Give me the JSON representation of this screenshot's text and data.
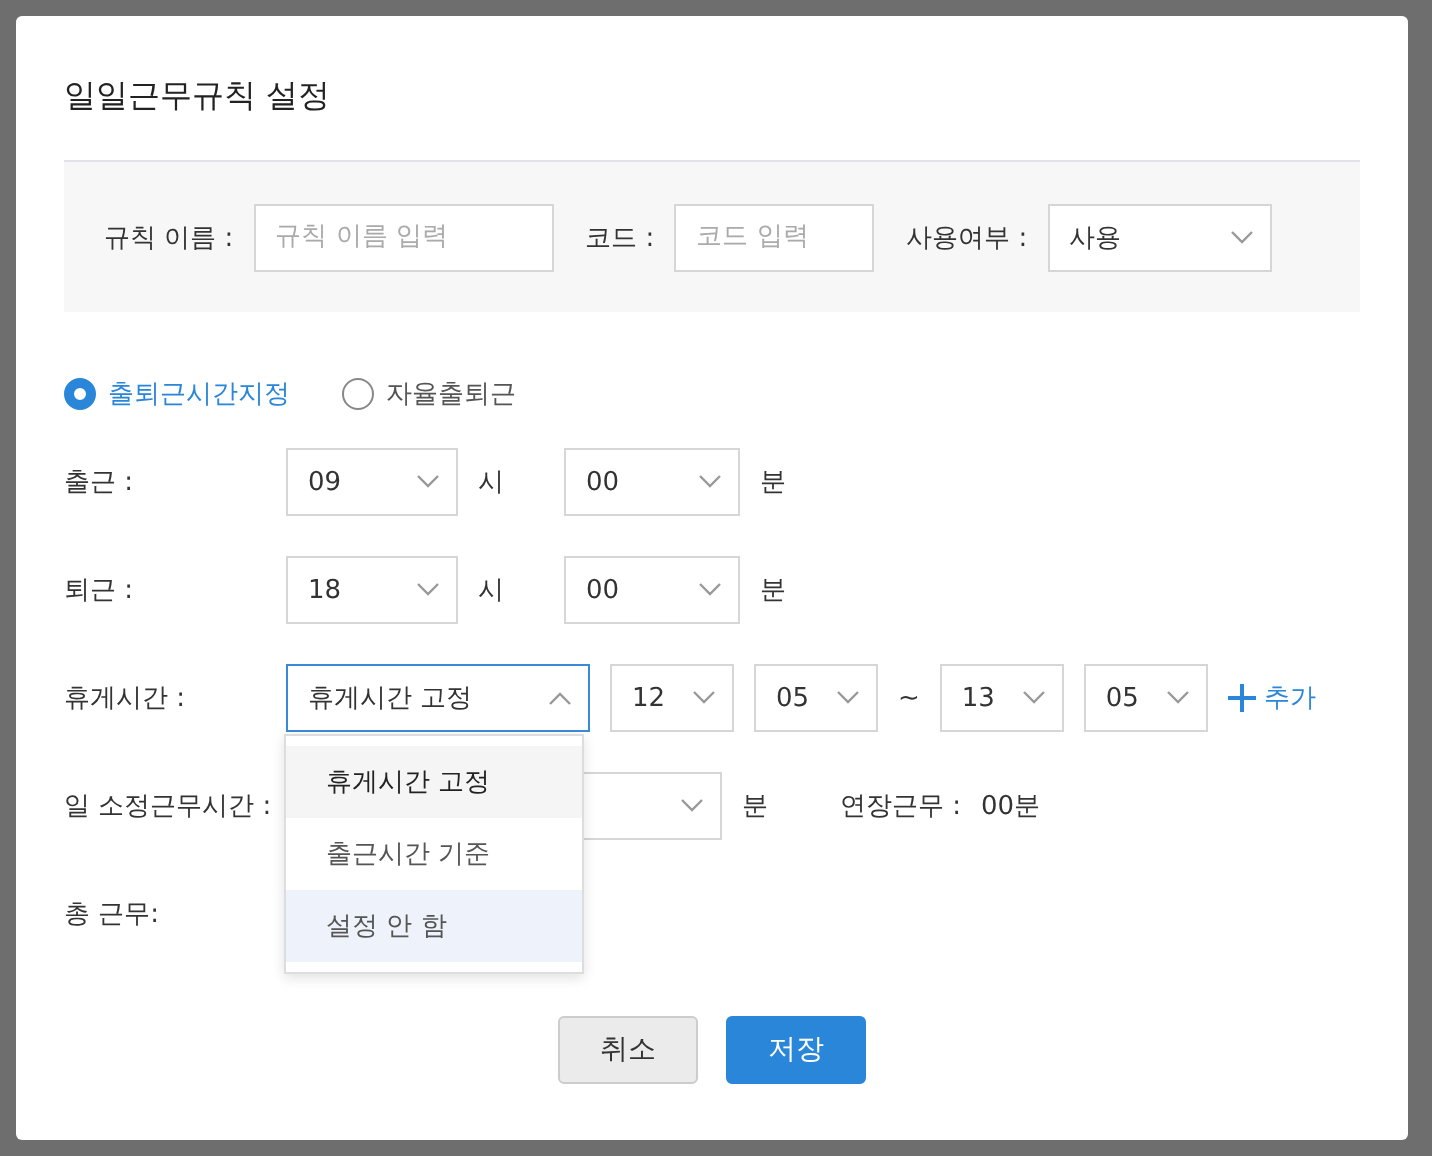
{
  "dialog": {
    "title": "일일근무규칙 설정"
  },
  "filter_bar": {
    "name_label": "규칙 이름 :",
    "name_placeholder": "규칙 이름 입력",
    "code_label": "코드 :",
    "code_placeholder": "코드 입력",
    "use_label": "사용여부 :",
    "use_value": "사용"
  },
  "mode_options": [
    {
      "label": "출퇴근시간지정",
      "selected": true
    },
    {
      "label": "자율출퇴근",
      "selected": false
    }
  ],
  "clock_in": {
    "label": "출근 :",
    "hour": "09",
    "hour_unit": "시",
    "minute": "00",
    "minute_unit": "분"
  },
  "clock_out": {
    "label": "퇴근 :",
    "hour": "18",
    "hour_unit": "시",
    "minute": "00",
    "minute_unit": "분"
  },
  "break_time": {
    "label": "휴게시간 :",
    "type_value": "휴게시간 고정",
    "expanded": true,
    "start_hour": "12",
    "start_minute": "05",
    "separator": "~",
    "end_hour": "13",
    "end_minute": "05",
    "add_label": "추가",
    "options": [
      {
        "label": "휴게시간 고정",
        "selected": true,
        "hovered": false
      },
      {
        "label": "출근시간 기준",
        "selected": false,
        "hovered": false
      },
      {
        "label": "설정 안 함",
        "selected": false,
        "hovered": true
      }
    ]
  },
  "daily_work": {
    "label": "일 소정근무시간 :",
    "minute_unit": "분",
    "overtime_label": "연장근무 :",
    "overtime_value": "00분"
  },
  "total_work": {
    "label": "총 근무:"
  },
  "buttons": [
    {
      "label": "취소",
      "kind": "secondary"
    },
    {
      "label": "저장",
      "kind": "primary"
    }
  ]
}
